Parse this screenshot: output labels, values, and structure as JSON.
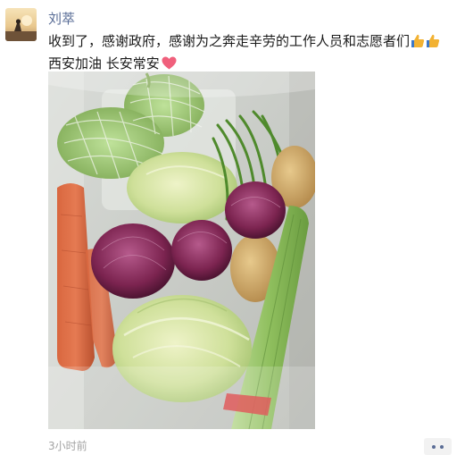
{
  "post": {
    "author": "刘萃",
    "text_line1": "收到了，感谢政府，感谢为之奔走辛劳的工作人员和志愿者们",
    "text_line2": "西安加油  长安常安",
    "timestamp": "3小时前",
    "emojis": [
      "thumbs-up-icon",
      "thumbs-up-icon",
      "heart-icon"
    ]
  },
  "colors": {
    "author_link": "#576b95",
    "text": "#1a1a1a",
    "timestamp": "#a3a3a3",
    "heart": "#f0607c",
    "thumb": "#f2b233"
  }
}
